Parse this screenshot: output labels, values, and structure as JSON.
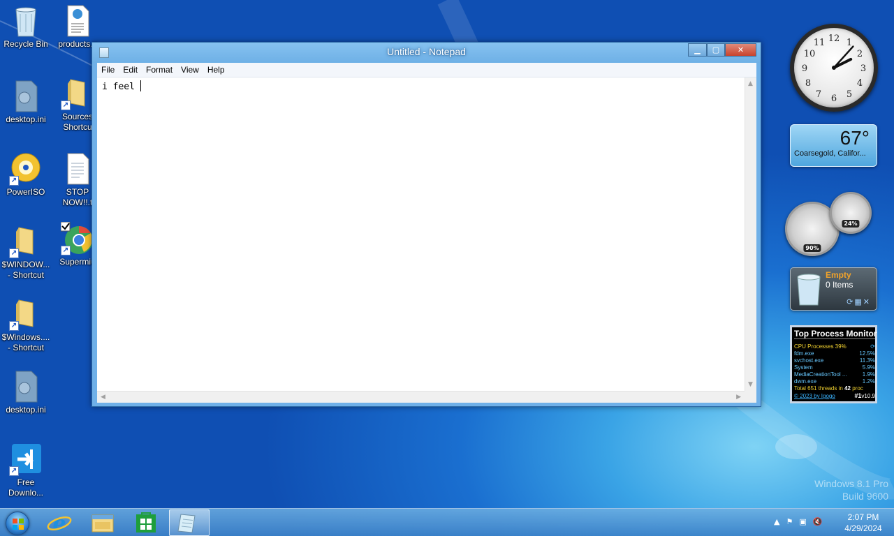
{
  "desktop": {
    "icons": [
      {
        "label": "Recycle Bin"
      },
      {
        "label": "products.x"
      },
      {
        "label": "desktop.ini"
      },
      {
        "label": "Sources\nShortcu"
      },
      {
        "label": "PowerISO"
      },
      {
        "label": "STOP\nNOW!!.t"
      },
      {
        "label": "$WINDOW...\n- Shortcut"
      },
      {
        "label": "Supermiu"
      },
      {
        "label": "$Windows....\n- Shortcut"
      },
      {
        "label": "desktop.ini"
      },
      {
        "label": "Free\nDownlo..."
      }
    ]
  },
  "notepad": {
    "title": "Untitled - Notepad",
    "menu": [
      "File",
      "Edit",
      "Format",
      "View",
      "Help"
    ],
    "content": "i feel "
  },
  "gadgets": {
    "clock": {
      "hour": 2,
      "minute": 7
    },
    "weather": {
      "temp": "67°",
      "location": "Coarsegold, Califor..."
    },
    "cpu_meter": {
      "cpu": "90%",
      "ram": "24%"
    },
    "recycle_bin": {
      "status": "Empty",
      "count": "0 Items"
    },
    "top_process_monitor": {
      "title": "Top Process Monitor",
      "cpu_line": "CPU Processes 39%",
      "processes": [
        {
          "name": "fdm.exe",
          "value": "12.5%"
        },
        {
          "name": "svchost.exe",
          "value": "11.3%"
        },
        {
          "name": "System",
          "value": "5.9%"
        },
        {
          "name": "MediaCreationTool ...",
          "value": "1.9%"
        },
        {
          "name": "dwm.exe",
          "value": "1.2%"
        }
      ],
      "total_prefix": "Total 651 threads in",
      "total_num": "42",
      "total_suffix": "proc",
      "footer_link": "© 2023 by Igogo",
      "rank": "#1",
      "version": "v10.9"
    }
  },
  "watermark": {
    "line1": "Windows 8.1 Pro",
    "line2": "Build 9600"
  },
  "taskbar": {
    "items": [
      "start-button",
      "internet-explorer",
      "file-explorer",
      "store",
      "notepad"
    ],
    "time": "2:07 PM",
    "date": "4/29/2024"
  },
  "colors": {
    "desktop": "#1a6fd0",
    "titlebar": "#6eb0e6",
    "close_button": "#c8432e",
    "tpm_text": "#67c8ff",
    "tpm_highlight": "#f2d230"
  }
}
